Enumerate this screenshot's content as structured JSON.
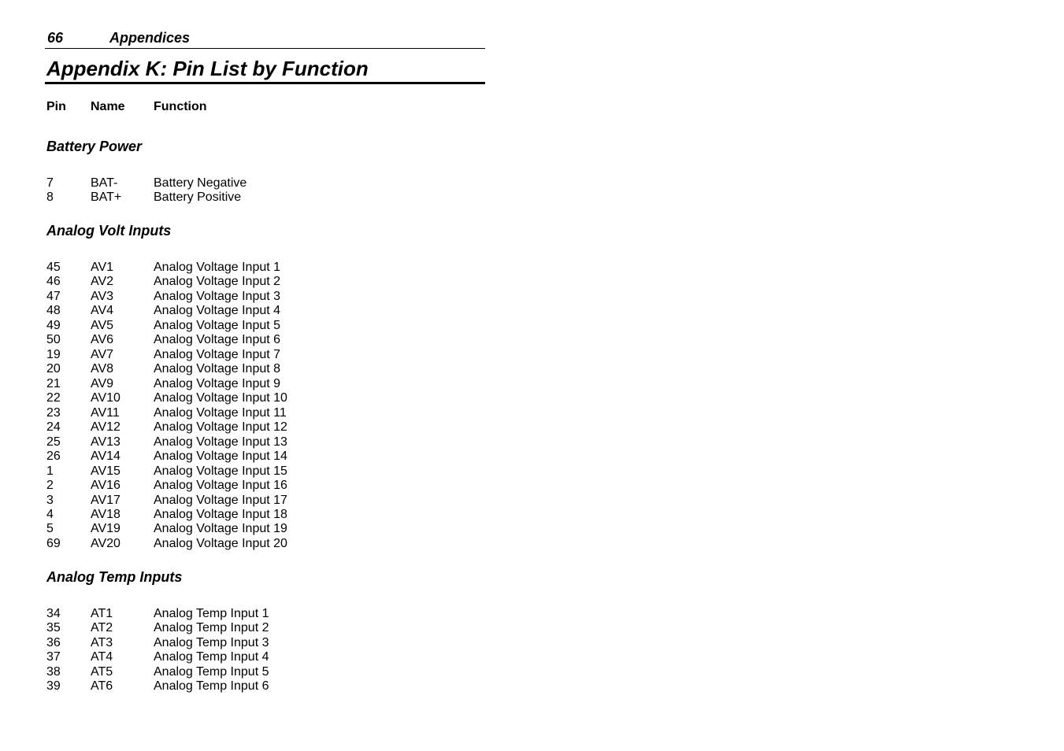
{
  "header": {
    "page_number": "66",
    "running_title": "Appendices"
  },
  "chapter_title": "Appendix K: Pin List by Function",
  "columns": {
    "pin": "Pin",
    "name": "Name",
    "function": "Function"
  },
  "sections": [
    {
      "title": "Battery Power",
      "rows": [
        {
          "pin": "7",
          "name": "BAT-",
          "function": "Battery Negative"
        },
        {
          "pin": "8",
          "name": "BAT+",
          "function": "Battery Positive"
        }
      ]
    },
    {
      "title": "Analog Volt Inputs",
      "rows": [
        {
          "pin": "45",
          "name": "AV1",
          "function": "Analog Voltage Input 1"
        },
        {
          "pin": "46",
          "name": "AV2",
          "function": "Analog Voltage Input 2"
        },
        {
          "pin": "47",
          "name": "AV3",
          "function": "Analog Voltage Input 3"
        },
        {
          "pin": "48",
          "name": "AV4",
          "function": "Analog Voltage Input 4"
        },
        {
          "pin": "49",
          "name": "AV5",
          "function": "Analog Voltage Input 5"
        },
        {
          "pin": "50",
          "name": "AV6",
          "function": "Analog Voltage Input 6"
        },
        {
          "pin": "19",
          "name": "AV7",
          "function": "Analog Voltage Input 7"
        },
        {
          "pin": "20",
          "name": "AV8",
          "function": "Analog Voltage Input 8"
        },
        {
          "pin": "21",
          "name": "AV9",
          "function": "Analog Voltage Input 9"
        },
        {
          "pin": "22",
          "name": "AV10",
          "function": "Analog Voltage Input 10"
        },
        {
          "pin": "23",
          "name": "AV11",
          "function": "Analog Voltage Input 11"
        },
        {
          "pin": "24",
          "name": "AV12",
          "function": "Analog Voltage Input 12"
        },
        {
          "pin": "25",
          "name": "AV13",
          "function": "Analog Voltage Input 13"
        },
        {
          "pin": "26",
          "name": "AV14",
          "function": "Analog Voltage Input 14"
        },
        {
          "pin": "1",
          "name": "AV15",
          "function": "Analog Voltage Input 15"
        },
        {
          "pin": "2",
          "name": "AV16",
          "function": "Analog Voltage Input 16"
        },
        {
          "pin": "3",
          "name": "AV17",
          "function": "Analog Voltage Input 17"
        },
        {
          "pin": "4",
          "name": "AV18",
          "function": "Analog Voltage Input 18"
        },
        {
          "pin": "5",
          "name": "AV19",
          "function": "Analog Voltage Input 19"
        },
        {
          "pin": "69",
          "name": "AV20",
          "function": "Analog Voltage Input 20"
        }
      ]
    },
    {
      "title": "Analog Temp Inputs",
      "rows": [
        {
          "pin": "34",
          "name": "AT1",
          "function": "Analog Temp Input 1"
        },
        {
          "pin": "35",
          "name": "AT2",
          "function": "Analog Temp Input 2"
        },
        {
          "pin": "36",
          "name": "AT3",
          "function": "Analog Temp Input 3"
        },
        {
          "pin": "37",
          "name": "AT4",
          "function": "Analog Temp Input 4"
        },
        {
          "pin": "38",
          "name": "AT5",
          "function": "Analog Temp Input 5"
        },
        {
          "pin": "39",
          "name": "AT6",
          "function": "Analog Temp Input 6"
        }
      ]
    }
  ]
}
